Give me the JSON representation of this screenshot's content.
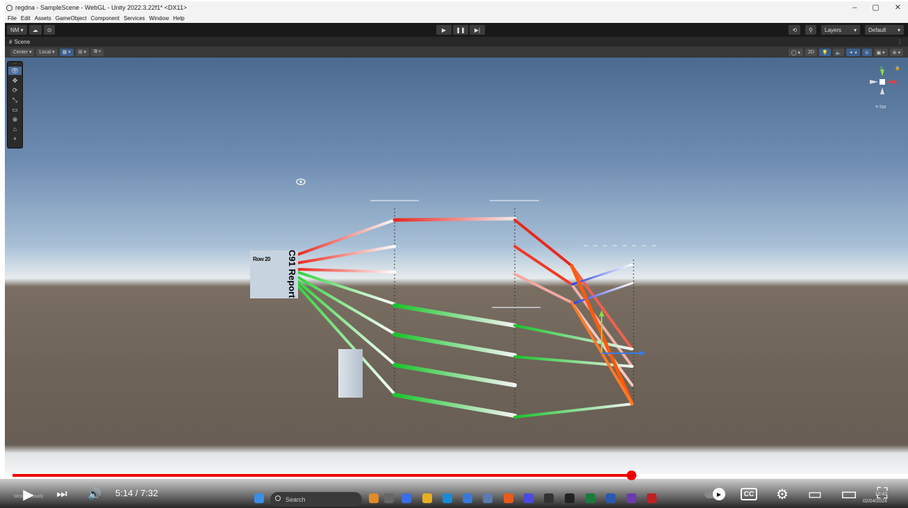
{
  "window": {
    "title": "regdna - SampleScene - WebGL - Unity 2022.3.22f1* <DX11>",
    "minimize": "–",
    "maximize": "▢",
    "close": "✕"
  },
  "menu": [
    "File",
    "Edit",
    "Assets",
    "GameObject",
    "Component",
    "Services",
    "Window",
    "Help"
  ],
  "unity_toolbar": {
    "account": "NM ▾",
    "cloud": "☁",
    "collab": "⊙",
    "play": "▶",
    "pause": "❚❚",
    "step": "▶|",
    "history": "⟲",
    "search": "⚲",
    "layers": "Layers",
    "layout": "Default"
  },
  "scene_tab": {
    "label": "Scene",
    "menu": "⋮"
  },
  "scene_toolbar": {
    "pivot": "Center ▾",
    "space": "Local ▾",
    "grid": "▦ ▾",
    "snap": "⊞ ▾",
    "incremental": "⧉ ▾",
    "draw_mode": "◯ ▾",
    "mode_2d": "2D",
    "lighting": "💡",
    "audio": "🔈",
    "effects": "✦ ▾",
    "hidden": "⊘",
    "camera": "▣ ▾",
    "gizmos": "⊕ ▾"
  },
  "tools": [
    "👁",
    "✥",
    "⟳",
    "⤡",
    "▭",
    "⊗",
    "⌂",
    "+"
  ],
  "gizmo": {
    "y": "y",
    "x": "x",
    "mode": "≡ Iso"
  },
  "scene": {
    "report_title": "C91 Report",
    "row_label": "Row 20"
  },
  "video": {
    "time": "5:14 / 7:32",
    "progress": 0.698,
    "buffered": 0.748,
    "play": "▶",
    "next": "⏭",
    "volume": "🔊",
    "captions": "CC",
    "settings": "⚙",
    "miniplayer": "▭",
    "theater": "▭",
    "fullscreen": "⛶"
  },
  "taskbar": {
    "weather_temp": "",
    "weather_desc": "Mostly cloudy",
    "search": "Search",
    "time": "10:43",
    "date": "02/04/2024"
  },
  "colors": {
    "unity_dark": "#191919",
    "red_line": "#e8281e",
    "green_line": "#18c42a",
    "blue_line": "#2838e8",
    "orange_line": "#ff5a0a",
    "progress": "#ee0000"
  }
}
